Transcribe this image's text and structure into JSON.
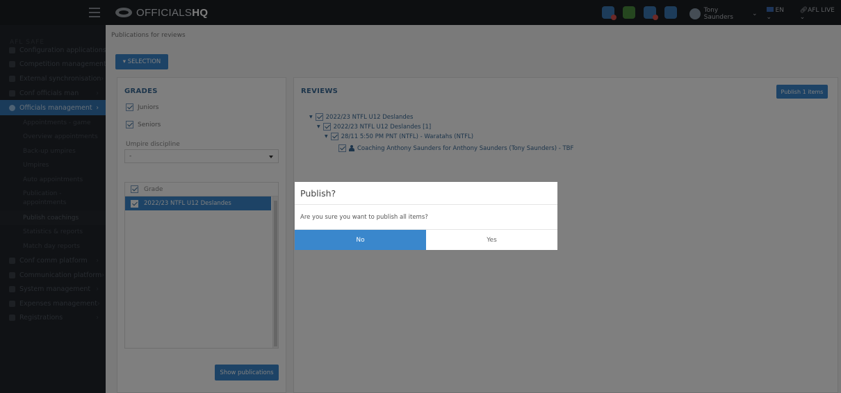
{
  "app": {
    "logo_text": "OFFICIALS",
    "logo_bold": "HQ",
    "user_name": "Tony Saunders",
    "language": "EN",
    "org": "AFL LIVE"
  },
  "sidebar": {
    "heading": "AFL SAFE",
    "items": [
      {
        "label": "Configuration applications",
        "arrow": ""
      },
      {
        "label": "Competition management",
        "arrow": ""
      },
      {
        "label": "External synchronisation",
        "arrow": "›"
      },
      {
        "label": "Conf officials man",
        "arrow": "›"
      },
      {
        "label": "Officials management",
        "arrow": "›"
      }
    ],
    "subitems": [
      "Appointments - game",
      "Overview appointments",
      "Back-up umpires",
      "Umpires",
      "Auto appointments",
      "Publication - appointments",
      "Publish coachings",
      "Statistics & reports",
      "Match day reports"
    ],
    "items_after": [
      {
        "label": "Conf comm platform",
        "arrow": "›"
      },
      {
        "label": "Communication platform",
        "arrow": "›"
      },
      {
        "label": "System management",
        "arrow": "›"
      },
      {
        "label": "Expenses management",
        "arrow": "›"
      },
      {
        "label": "Registrations",
        "arrow": "›"
      }
    ]
  },
  "content": {
    "breadcrumb": "Publications for reviews",
    "selection_button": "▾ SELECTION",
    "grades_panel": {
      "title": "GRADES",
      "options": [
        "Juniors",
        "Seniors"
      ],
      "umpire_discipline_label": "Umpire discipline",
      "umpire_discipline_value": "-",
      "table_header": "Grade",
      "table_rows": [
        "2022/23 NTFL U12 Deslandes"
      ],
      "show_button": "Show publications"
    },
    "reviews_panel": {
      "title": "REVIEWS",
      "publish_button": "Publish 1 items",
      "tree": [
        "2022/23 NTFL U12 Deslandes",
        "2022/23 NTFL U12 Deslandes [1]",
        "28/11 5:50 PM PNT (NTFL) - Waratahs (NTFL)",
        "Coaching Anthony Saunders for Anthony Saunders (Tony Saunders) - TBF"
      ]
    }
  },
  "modal": {
    "title": "Publish?",
    "message": "Are you sure you want to publish all items?",
    "no_label": "No",
    "yes_label": "Yes"
  },
  "colors": {
    "accent": "#3a87cc",
    "topbar": "#1b1e23",
    "sidebar": "#20242a"
  }
}
